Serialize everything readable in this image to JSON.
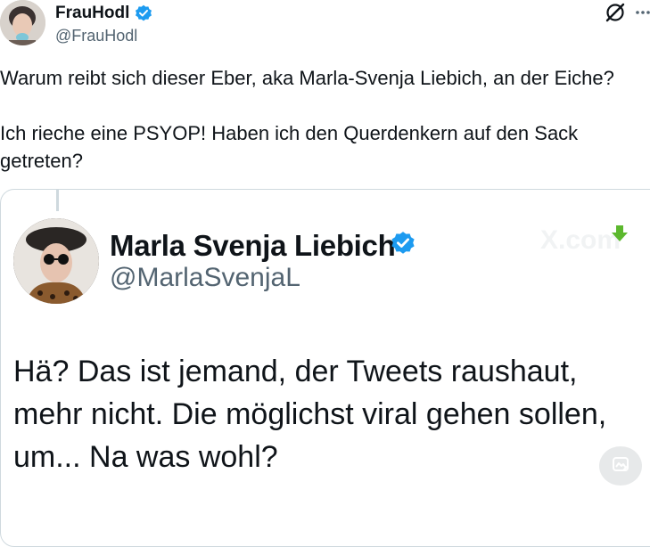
{
  "author": {
    "display_name": "FrauHodl",
    "handle": "@FrauHodl",
    "verified": true
  },
  "tweet": {
    "line1": "Warum reibt sich dieser Eber, aka Marla-Svenja Liebich, an der Eiche?",
    "line2": "Ich rieche eine PSYOP! Haben ich den Querdenkern auf den Sack",
    "line3": "getreten?"
  },
  "quoted": {
    "display_name": "Marla Svenja Liebich",
    "handle": "@MarlaSvenjaL",
    "verified": true,
    "watermark": "X.com",
    "text_line1": "Hä? Das ist jemand, der Tweets raushaut,",
    "text_line2": "mehr nicht. Die möglichst viral gehen sollen,",
    "text_line3": "um... Na was wohl?"
  },
  "icons": {
    "grok": "grok-icon",
    "more": "more-icon",
    "verified": "verified-badge-icon",
    "download": "download-arrow-icon",
    "image_action": "image-action-icon"
  },
  "colors": {
    "verified_blue": "#1d9bf0",
    "download_green": "#5cb82e",
    "secondary_text": "#536471"
  }
}
